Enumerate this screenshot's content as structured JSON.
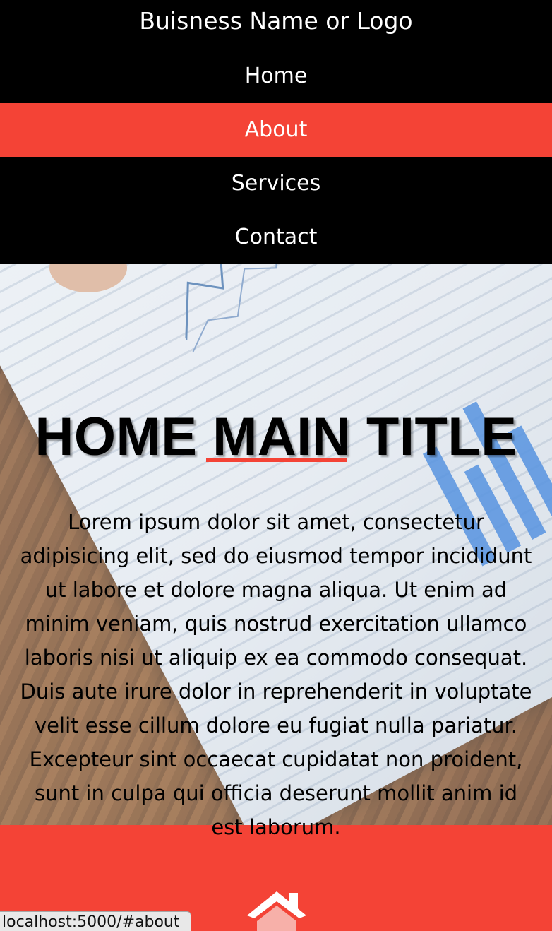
{
  "header": {
    "brand": "Buisness Name or Logo"
  },
  "nav": {
    "items": [
      {
        "label": "Home",
        "active": false
      },
      {
        "label": "About",
        "active": true
      },
      {
        "label": "Services",
        "active": false
      },
      {
        "label": "Contact",
        "active": false
      }
    ]
  },
  "hero": {
    "title": "HOME MAIN TITLE",
    "text": "Lorem ipsum dolor sit amet, consectetur adipisicing elit, sed do eiusmod tempor incididunt ut labore et dolore magna aliqua. Ut enim ad minim veniam, quis nostrud exercitation ullamco laboris nisi ut aliquip ex ea commodo consequat. Duis aute irure dolor in reprehenderit in voluptate velit esse cillum dolore eu fugiat nulla pariatur. Excepteur sint occaecat cupidatat non proident, sunt in culpa qui officia deserunt mollit anim id est laborum."
  },
  "section": {
    "icon": "home-icon"
  },
  "status_bar": {
    "url": "localhost:5000/#about"
  },
  "colors": {
    "accent": "#f44336",
    "nav_bg": "#000000",
    "text_light": "#ffffff"
  }
}
